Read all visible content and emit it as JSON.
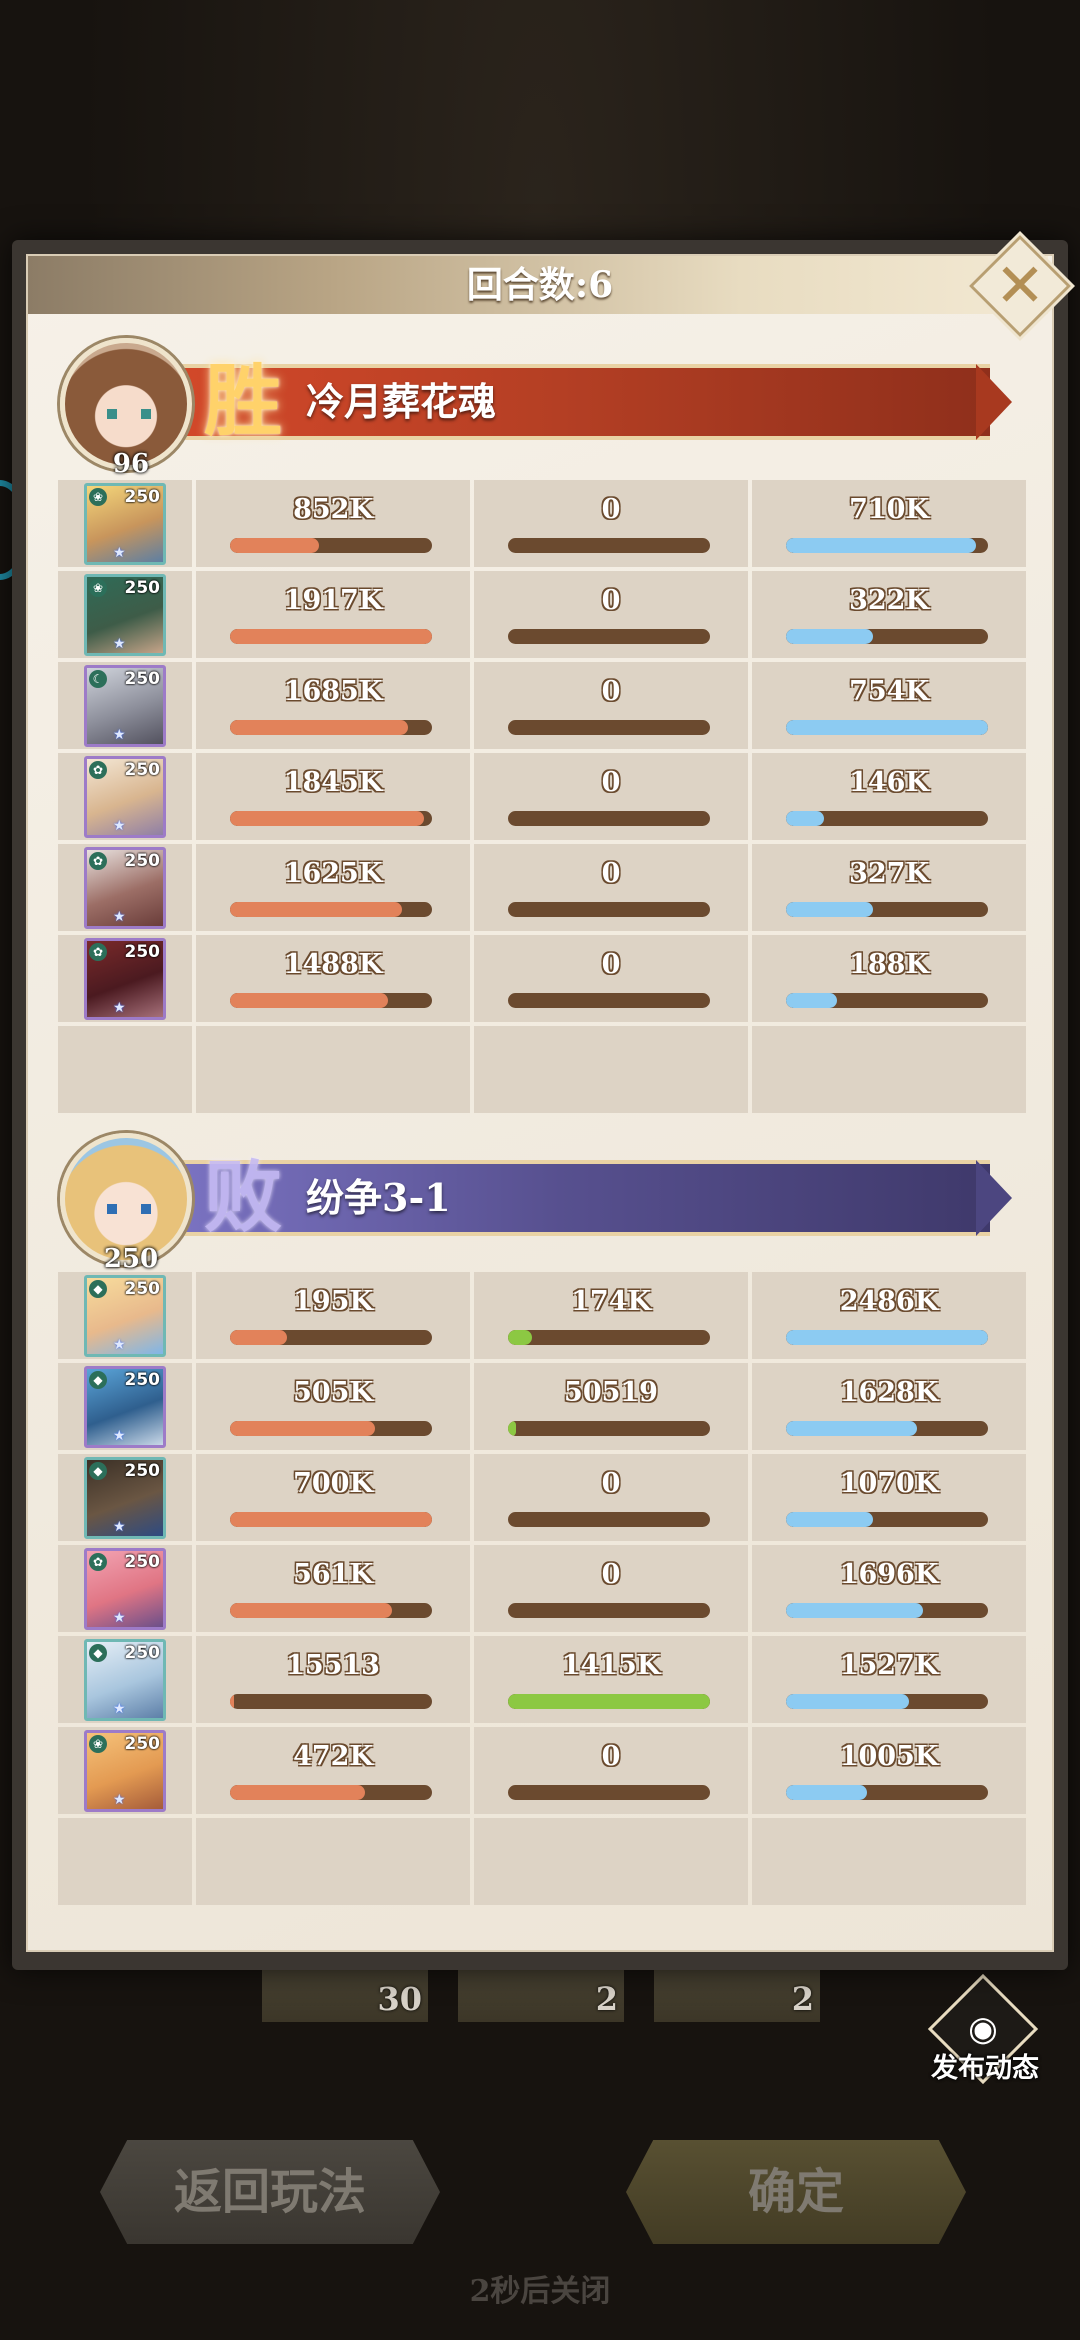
{
  "header": {
    "title": "回合数:6",
    "close_icon": "close-icon"
  },
  "teams": [
    {
      "result": "胜",
      "name": "冷月葬花魂",
      "level": "96",
      "result_color": "#c0452a",
      "rows": [
        {
          "hero_level": "250",
          "damage": "852K",
          "damage_ratio": 0.44,
          "heal": "0",
          "heal_ratio": 0,
          "taken": "710K",
          "taken_ratio": 0.94
        },
        {
          "hero_level": "250",
          "damage": "1917K",
          "damage_ratio": 1.0,
          "heal": "0",
          "heal_ratio": 0,
          "taken": "322K",
          "taken_ratio": 0.43
        },
        {
          "hero_level": "250",
          "damage": "1685K",
          "damage_ratio": 0.88,
          "heal": "0",
          "heal_ratio": 0,
          "taken": "754K",
          "taken_ratio": 1.0
        },
        {
          "hero_level": "250",
          "damage": "1845K",
          "damage_ratio": 0.96,
          "heal": "0",
          "heal_ratio": 0,
          "taken": "146K",
          "taken_ratio": 0.19
        },
        {
          "hero_level": "250",
          "damage": "1625K",
          "damage_ratio": 0.85,
          "heal": "0",
          "heal_ratio": 0,
          "taken": "327K",
          "taken_ratio": 0.43
        },
        {
          "hero_level": "250",
          "damage": "1488K",
          "damage_ratio": 0.78,
          "heal": "0",
          "heal_ratio": 0,
          "taken": "188K",
          "taken_ratio": 0.25
        }
      ]
    },
    {
      "result": "败",
      "name": "纷争3-1",
      "level": "250",
      "result_color": "#5a5196",
      "rows": [
        {
          "hero_level": "250",
          "damage": "195K",
          "damage_ratio": 0.28,
          "heal": "174K",
          "heal_ratio": 0.12,
          "taken": "2486K",
          "taken_ratio": 1.0
        },
        {
          "hero_level": "250",
          "damage": "505K",
          "damage_ratio": 0.72,
          "heal": "50519",
          "heal_ratio": 0.04,
          "taken": "1628K",
          "taken_ratio": 0.65
        },
        {
          "hero_level": "250",
          "damage": "700K",
          "damage_ratio": 1.0,
          "heal": "0",
          "heal_ratio": 0,
          "taken": "1070K",
          "taken_ratio": 0.43
        },
        {
          "hero_level": "250",
          "damage": "561K",
          "damage_ratio": 0.8,
          "heal": "0",
          "heal_ratio": 0,
          "taken": "1696K",
          "taken_ratio": 0.68
        },
        {
          "hero_level": "250",
          "damage": "15513",
          "damage_ratio": 0.02,
          "heal": "1415K",
          "heal_ratio": 1.0,
          "taken": "1527K",
          "taken_ratio": 0.61
        },
        {
          "hero_level": "250",
          "damage": "472K",
          "damage_ratio": 0.67,
          "heal": "0",
          "heal_ratio": 0,
          "taken": "1005K",
          "taken_ratio": 0.4
        }
      ]
    }
  ],
  "rewards": [
    {
      "count": "30"
    },
    {
      "count": "2"
    },
    {
      "count": "2"
    }
  ],
  "share": {
    "label": "发布动态",
    "icon": "camera-icon"
  },
  "buttons": {
    "back": "返回玩法",
    "confirm": "确定"
  },
  "countdown": "2秒后关闭"
}
